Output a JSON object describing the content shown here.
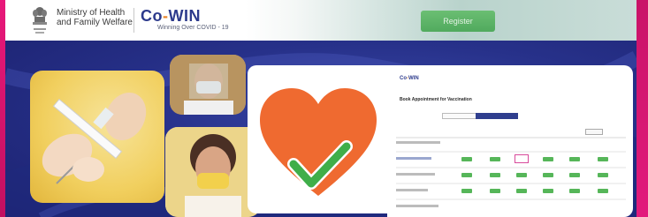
{
  "header": {
    "ministry_line1": "Ministry of Health",
    "ministry_line2": "and Family Welfare",
    "brand_prefix": "Co",
    "brand_dash": "-",
    "brand_suffix": "WIN",
    "tagline": "Winning Over COVID - 19",
    "register_label": "Register"
  },
  "banner": {
    "heart_icon": "heart-with-checkmark-icon",
    "screenshot_title": "Book Appointment for Vaccination",
    "photos": [
      "syringe-photo",
      "man-with-face-shield-photo",
      "woman-with-mask-photo"
    ]
  },
  "colors": {
    "edge": "#e21a7c",
    "brand_blue": "#2c3a8c",
    "brand_orange": "#e8852c",
    "banner_blue": "#27318a",
    "heart_orange": "#ef6a30",
    "check_green": "#3fae49",
    "register_green": "#4caf50"
  }
}
